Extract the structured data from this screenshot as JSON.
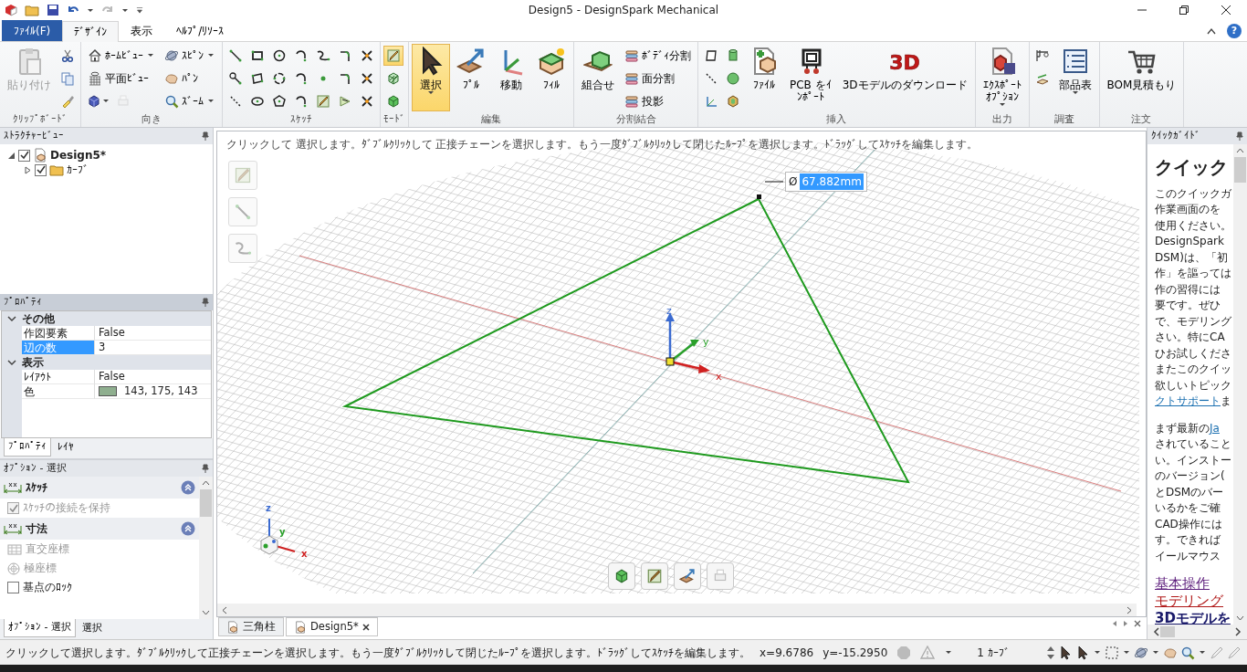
{
  "window": {
    "title": "Design5 - DesignSpark Mechanical"
  },
  "ribbon_tabs": [
    {
      "label": "ﾌｧｲﾙ(F)",
      "kind": "file",
      "selected": false
    },
    {
      "label": "ﾃﾞｻﾞｲﾝ",
      "kind": "tab",
      "selected": true
    },
    {
      "label": "表示",
      "kind": "tab",
      "selected": false
    },
    {
      "label": "ﾍﾙﾌﾟ/ﾘｿｰｽ",
      "kind": "tab",
      "selected": false
    }
  ],
  "help_button": "?",
  "ribbon_groups": [
    {
      "label": "ｸﾘｯﾌﾟﾎﾞｰﾄﾞ",
      "columns": [
        [
          [
            {
              "kind": "large",
              "label": "貼り付け",
              "disabled": true
            }
          ]
        ],
        [
          [
            {
              "kind": "icon"
            }
          ],
          [
            {
              "kind": "icon"
            }
          ],
          [
            {
              "kind": "icon"
            }
          ]
        ]
      ]
    },
    {
      "label": "向き",
      "columns": [
        [
          [
            {
              "kind": "small",
              "label": "ﾎｰﾑﾋﾞｭｰ",
              "dropdown": true
            }
          ],
          [
            {
              "kind": "small",
              "label": "平面ﾋﾞｭｰ"
            }
          ],
          [
            {
              "kind": "icon",
              "dropdown": true
            },
            {
              "kind": "icon",
              "disabled": true
            }
          ]
        ],
        [
          [
            {
              "kind": "small",
              "label": "ｽﾋﾟﾝ",
              "dropdown": true
            }
          ],
          [
            {
              "kind": "small",
              "label": "ﾊﾟﾝ"
            }
          ],
          [
            {
              "kind": "small",
              "label": "ｽﾞｰﾑ",
              "dropdown": true
            }
          ]
        ]
      ]
    },
    {
      "label": "ｽｹｯﾁ",
      "columns": [
        [
          [
            {
              "kind": "icon"
            }
          ],
          [
            {
              "kind": "icon"
            }
          ],
          [
            {
              "kind": "icon"
            }
          ]
        ],
        [
          [
            {
              "kind": "icon"
            }
          ],
          [
            {
              "kind": "icon"
            }
          ],
          [
            {
              "kind": "icon"
            }
          ]
        ],
        [
          [
            {
              "kind": "icon"
            }
          ],
          [
            {
              "kind": "icon"
            }
          ],
          [
            {
              "kind": "icon"
            }
          ]
        ],
        [
          [
            {
              "kind": "icon"
            }
          ],
          [
            {
              "kind": "icon"
            }
          ],
          [
            {
              "kind": "icon"
            }
          ]
        ],
        [
          [
            {
              "kind": "icon"
            }
          ],
          [
            {
              "kind": "icon"
            }
          ],
          [
            {
              "kind": "icon"
            }
          ]
        ],
        [
          [
            {
              "kind": "icon"
            }
          ],
          [
            {
              "kind": "icon"
            }
          ],
          [
            {
              "kind": "icon"
            }
          ]
        ],
        [
          [
            {
              "kind": "icon"
            }
          ],
          [
            {
              "kind": "icon"
            }
          ],
          [
            {
              "kind": "icon"
            }
          ]
        ]
      ]
    },
    {
      "label": "ﾓｰﾄﾞ",
      "columns": [
        [
          [
            {
              "kind": "icon",
              "selected": true
            }
          ],
          [
            {
              "kind": "icon",
              "selected": false
            }
          ],
          [
            {
              "kind": "icon",
              "selected": false
            }
          ]
        ]
      ]
    },
    {
      "label": "編集",
      "columns": [
        [
          [
            {
              "kind": "large",
              "label": "選択",
              "dropdown": true,
              "selected": true
            }
          ]
        ],
        [
          [
            {
              "kind": "large",
              "label": "ﾌﾟﾙ",
              "selected": false
            }
          ]
        ],
        [
          [
            {
              "kind": "large",
              "label": "移動",
              "selected": false
            }
          ]
        ],
        [
          [
            {
              "kind": "large",
              "label": "ﾌｨﾙ",
              "selected": false
            }
          ]
        ]
      ]
    },
    {
      "label": "分割結合",
      "columns": [
        [
          [
            {
              "kind": "large",
              "label": "組合せ"
            }
          ]
        ],
        [
          [
            {
              "kind": "small",
              "label": "ﾎﾞﾃﾞｨ分割"
            }
          ],
          [
            {
              "kind": "small",
              "label": "面分割"
            }
          ],
          [
            {
              "kind": "small",
              "label": "投影"
            }
          ]
        ]
      ]
    },
    {
      "label": "挿入",
      "columns": [
        [
          [
            {
              "kind": "icon"
            }
          ],
          [
            {
              "kind": "icon"
            }
          ],
          [
            {
              "kind": "icon"
            }
          ]
        ],
        [
          [
            {
              "kind": "icon"
            }
          ],
          [
            {
              "kind": "icon"
            }
          ],
          [
            {
              "kind": "icon"
            }
          ]
        ],
        [
          [
            {
              "kind": "large",
              "label": "ﾌｧｲﾙ"
            }
          ]
        ],
        [
          [
            {
              "kind": "large",
              "lines": [
                "PCB をｲ",
                "ﾝﾎﾟｰﾄ"
              ]
            }
          ]
        ],
        [
          [
            {
              "kind": "large",
              "label": "3Dモデルのダウンロード",
              "logo": "3D"
            }
          ]
        ]
      ]
    },
    {
      "label": "出力",
      "columns": [
        [
          [
            {
              "kind": "large",
              "lines": [
                "ｴｸｽﾎﾟｰﾄ",
                "ｵﾌﾟｼｮﾝ"
              ],
              "dropdown": true
            }
          ]
        ]
      ]
    },
    {
      "label": "調査",
      "columns": [
        [
          [
            {
              "kind": "icon"
            }
          ],
          [
            {
              "kind": "icon"
            }
          ]
        ],
        [
          [
            {
              "kind": "large",
              "label": "部品表",
              "dropdown": true
            }
          ]
        ]
      ]
    },
    {
      "label": "注文",
      "columns": [
        [
          [
            {
              "kind": "large",
              "label": "BOM見積もり"
            }
          ]
        ]
      ]
    }
  ],
  "structure": {
    "title": "ｽﾄﾗｸﾁｬｰﾋﾞｭｰ",
    "items": [
      {
        "label": "Design5*",
        "checked": true,
        "expanded": true,
        "children": [
          {
            "label": "ｶｰﾌﾞ",
            "checked": true,
            "expanded": false
          }
        ]
      }
    ]
  },
  "properties": {
    "title": "ﾌﾟﾛﾊﾟﾃｨ",
    "sections": [
      {
        "label": "その他",
        "expanded": true,
        "rows": [
          {
            "name": "作図要素",
            "value": "False",
            "selected": false
          },
          {
            "name": "辺の数",
            "value": "3",
            "selected": true
          }
        ]
      },
      {
        "label": "表示",
        "expanded": true,
        "rows": [
          {
            "name": "ﾚｲｱｳﾄ",
            "value": "False",
            "selected": false
          },
          {
            "name": "色",
            "value": "143, 175, 143",
            "color": "#8faf8f",
            "selected": false
          }
        ]
      }
    ],
    "tabs": [
      {
        "label": "ﾌﾟﾛﾊﾟﾃｨ",
        "selected": true
      },
      {
        "label": "ﾚｲﾔ",
        "selected": false
      }
    ]
  },
  "options": {
    "title": "ｵﾌﾟｼｮﾝ - 選択",
    "sections": [
      {
        "label": "ｽｹｯﾁ",
        "items": [
          {
            "kind": "checkbox",
            "label": "ｽｹｯﾁの接続を保持",
            "checked": true,
            "disabled": true
          }
        ]
      },
      {
        "label": "寸法",
        "items": [
          {
            "kind": "cartesian",
            "label": "直交座標",
            "disabled": true
          },
          {
            "kind": "polar",
            "label": "極座標",
            "disabled": true
          },
          {
            "kind": "checkbox",
            "label": "基点のﾛｯｸ",
            "checked": false,
            "disabled": false
          }
        ]
      }
    ],
    "tabs": [
      {
        "label": "ｵﾌﾟｼｮﾝ - 選択",
        "selected": true
      },
      {
        "label": "選択",
        "selected": false
      }
    ]
  },
  "canvas": {
    "hint": "クリックして 選択します。ﾀﾞﾌﾞﾙｸﾘｯｸして 正接チェーンを選択します。もう一度ﾀﾞﾌﾞﾙｸﾘｯｸして閉じたﾙｰﾌﾟを選択します。ﾄﾞﾗｯｸﾞしてｽｹｯﾁを編集します。",
    "dimension": {
      "symbol": "Ø",
      "value": "67.882mm",
      "selected": true
    },
    "gizmo_labels": {
      "z": "z",
      "y": "y",
      "x": "x"
    },
    "triad_labels": {
      "z": "z",
      "y": "y",
      "x": "x"
    }
  },
  "doc_tabs": [
    {
      "label": "三角柱",
      "selected": false
    },
    {
      "label": "Design5*",
      "selected": true
    }
  ],
  "quick_guide": {
    "title": "ｸｲｯｸｶﾞｲﾄﾞ",
    "heading": "クイック",
    "paragraphs": [
      {
        "lines": [
          "このクイックガ",
          "作業画面のを",
          "使用ください。",
          "DesignSpark",
          "DSM)は、「初",
          "作」を謳っては",
          "作の習得には",
          "要です。ぜひ",
          "で、モデリング",
          "さい。特にCA",
          "ひお試しくださ",
          "またこのクイッ",
          "欲しいトピック",
          [
            {
              "text": "クトサポート",
              "link": true
            },
            {
              "text": "ま",
              "link": false
            }
          ]
        ]
      },
      {
        "lines": [
          [
            {
              "text": "まず最新の",
              "link": false
            },
            {
              "text": "Ja",
              "link": true
            }
          ],
          "されていること",
          "い。インストー",
          "のバージョン(",
          "とDSMのバー",
          "いるかをご確",
          "CAD操作には",
          "す。できれば",
          "イールマウス"
        ]
      }
    ],
    "links": [
      {
        "label": "基本操作",
        "color": "#5a1a7a"
      },
      {
        "label": "モデリング",
        "color": "#b01818"
      },
      {
        "label": "3Dモデルを",
        "color": "#1a1a6a"
      }
    ]
  },
  "status_bar": {
    "message": "クリックして選択します。ﾀﾞﾌﾞﾙｸﾘｯｸして正接チェーンを選択します。もう一度ﾀﾞﾌﾞﾙｸﾘｯｸして閉じたﾙｰﾌﾟを選択します。ﾄﾞﾗｯｸﾞしてｽｹｯﾁを編集します。",
    "x": "x=9.6786",
    "y": "y=-15.2950",
    "selection": "1 ｶｰﾌﾞ"
  }
}
